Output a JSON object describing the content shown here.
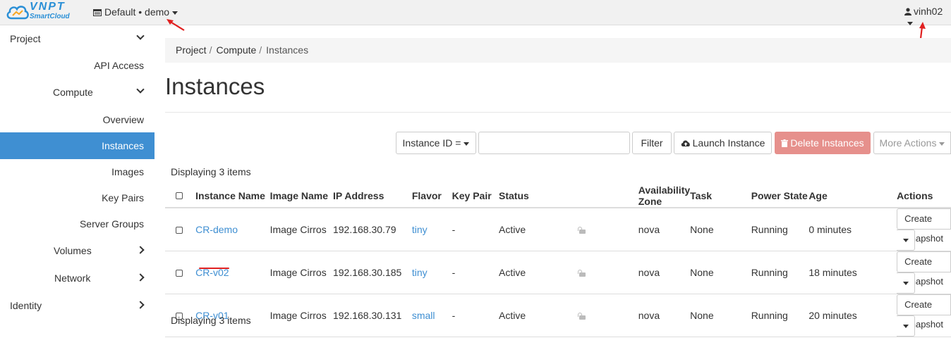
{
  "header": {
    "logo_text": "VNPT",
    "logo_subtext": "SmartCloud",
    "project_selector": "Default • demo",
    "user": "vinh02"
  },
  "sidebar": {
    "items": [
      {
        "label": "Project"
      },
      {
        "label": "API Access"
      },
      {
        "label": "Compute"
      },
      {
        "label": "Overview"
      },
      {
        "label": "Instances"
      },
      {
        "label": "Images"
      },
      {
        "label": "Key Pairs"
      },
      {
        "label": "Server Groups"
      },
      {
        "label": "Volumes"
      },
      {
        "label": "Network"
      },
      {
        "label": "Identity"
      }
    ]
  },
  "breadcrumb": {
    "project": "Project",
    "compute": "Compute",
    "current": "Instances",
    "separator": "/"
  },
  "page_title": "Instances",
  "toolbar": {
    "filter_field": "Instance ID =",
    "filter_input_value": "",
    "filter_button": "Filter",
    "launch_button": "Launch Instance",
    "delete_button": "Delete Instances",
    "more_actions": "More Actions"
  },
  "display_count": "Displaying 3 items",
  "table": {
    "headers": [
      "Instance Name",
      "Image Name",
      "IP Address",
      "Flavor",
      "Key Pair",
      "Status",
      "Availability Zone",
      "Task",
      "Power State",
      "Age",
      "Actions"
    ],
    "rows": [
      {
        "name": "CR-demo",
        "image": "Image Cirros",
        "ip": "192.168.30.79",
        "flavor": "tiny",
        "keypair": "-",
        "status": "Active",
        "zone": "nova",
        "task": "None",
        "power": "Running",
        "age": "0 minutes",
        "action": "Create Snapshot"
      },
      {
        "name": "CR-v02",
        "image": "Image Cirros",
        "ip": "192.168.30.185",
        "flavor": "tiny",
        "keypair": "-",
        "status": "Active",
        "zone": "nova",
        "task": "None",
        "power": "Running",
        "age": "18 minutes",
        "action": "Create Snapshot"
      },
      {
        "name": "CR-v01",
        "image": "Image Cirros",
        "ip": "192.168.30.131",
        "flavor": "small",
        "keypair": "-",
        "status": "Active",
        "zone": "nova",
        "task": "None",
        "power": "Running",
        "age": "20 minutes",
        "action": "Create Snapshot"
      }
    ]
  },
  "colors": {
    "accent": "#3f8fd2",
    "danger": "#e6908c",
    "annotation": "#e02020"
  }
}
